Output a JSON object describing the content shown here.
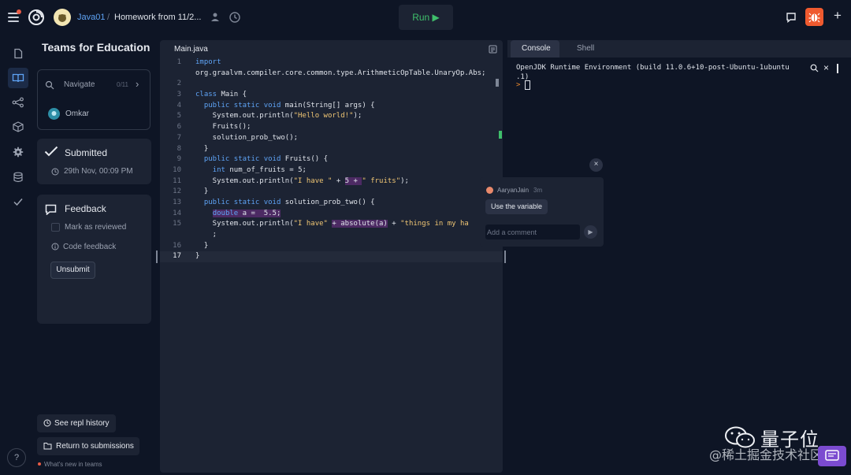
{
  "topbar": {
    "user": "Java01",
    "separator": "/",
    "repl_title": "Homework from 11/2...",
    "run_label": "Run ▶",
    "plus": "+"
  },
  "sidebar": {
    "title": "Teams for Education",
    "navigate_label": "Navigate",
    "navigate_count": "0/11",
    "user_name": "Omkar",
    "submitted": {
      "title": "Submitted",
      "date": "29th Nov, 00:09 PM"
    },
    "feedback": {
      "title": "Feedback",
      "mark_reviewed": "Mark as reviewed",
      "code_feedback": "Code feedback",
      "unsubmit": "Unsubmit"
    },
    "repl_history": "See repl history",
    "return_submissions": "Return to submissions",
    "whats_new": "What's new in teams",
    "help": "?"
  },
  "editor": {
    "tab": "Main.java",
    "current_line": 17,
    "lines": [
      {
        "n": "1",
        "html": "<span class=\"kw\">import</span>"
      },
      {
        "n": "",
        "html": "org.graalvm.compiler.core.common.type.ArithmeticOpTable.UnaryOp.Abs;"
      },
      {
        "n": "2",
        "html": ""
      },
      {
        "n": "3",
        "html": "<span class=\"kw\">class</span> Main {"
      },
      {
        "n": "4",
        "html": "  <span class=\"kw\">public static void</span> main(String[] args) {"
      },
      {
        "n": "5",
        "html": "    System.out.println(<span class=\"str\">\"Hello world!\"</span>);"
      },
      {
        "n": "6",
        "html": "    Fruits();"
      },
      {
        "n": "7",
        "html": "    solution_prob_two();"
      },
      {
        "n": "8",
        "html": "  }"
      },
      {
        "n": "9",
        "html": "  <span class=\"kw\">public static void</span> Fruits() {"
      },
      {
        "n": "10",
        "html": "    <span class=\"kw\">int</span> num_of_fruits = 5;"
      },
      {
        "n": "11",
        "html": "    System.out.println(<span class=\"str\">\"I have \"</span> + <span class=\"hl\">5 + </span><span class=\"str\">\" fruits\"</span>);"
      },
      {
        "n": "12",
        "html": "  }"
      },
      {
        "n": "13",
        "html": "  <span class=\"kw\">public static void</span> solution_prob_two() {"
      },
      {
        "n": "14",
        "html": "    <span class=\"hl\"><span class=\"kw\">double</span> a =  5.5;</span>"
      },
      {
        "n": "15",
        "html": "    System.out.println(<span class=\"str\">\"I have\"</span> <span class=\"hl\">+ absolute(a)</span> + <span class=\"str\">\"things in my ha</span>"
      },
      {
        "n": "",
        "html": "    ;"
      },
      {
        "n": "16",
        "html": "  }"
      },
      {
        "n": "17",
        "html": "}"
      }
    ]
  },
  "console": {
    "tabs": [
      "Console",
      "Shell"
    ],
    "output_line1": "OpenJDK Runtime Environment (build 11.0.6+10-post-Ubuntu-1ubuntu",
    "output_line2": ".1)",
    "prompt": ">"
  },
  "comment": {
    "close": "×",
    "author": "AaryanJain",
    "time": "3m",
    "text": "Use the variable",
    "input_placeholder": "Add a comment",
    "send": "▶"
  },
  "watermark": {
    "title": "量子位",
    "subtitle": "@稀土掘金技术社区"
  }
}
